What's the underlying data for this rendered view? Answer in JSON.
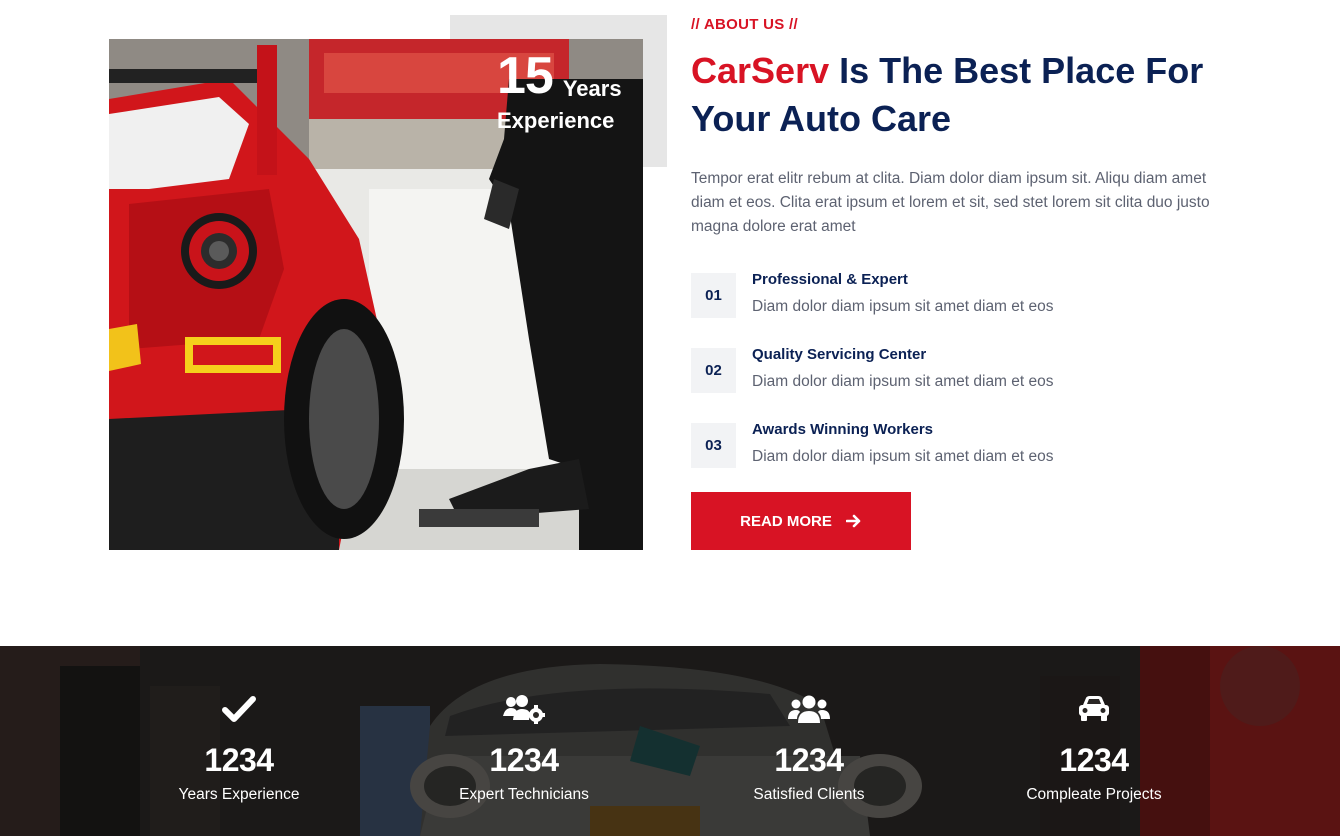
{
  "experience_badge": {
    "number": "15",
    "years": "Years",
    "label": "Experience"
  },
  "about": {
    "eyebrow": "// ABOUT US //",
    "headline_brand": "CarServ",
    "headline_rest": " Is The Best Place For Your Auto Care",
    "lead": "Tempor erat elitr rebum at clita. Diam dolor diam ipsum sit. Aliqu diam amet diam et eos. Clita erat ipsum et lorem et sit, sed stet lorem sit clita duo justo magna dolore erat amet",
    "features": [
      {
        "number": "01",
        "title": "Professional & Expert",
        "desc": "Diam dolor diam ipsum sit amet diam et eos"
      },
      {
        "number": "02",
        "title": "Quality Servicing Center",
        "desc": "Diam dolor diam ipsum sit amet diam et eos"
      },
      {
        "number": "03",
        "title": "Awards Winning Workers",
        "desc": "Diam dolor diam ipsum sit amet diam et eos"
      }
    ],
    "read_more_label": "READ MORE"
  },
  "facts": [
    {
      "icon": "check-icon",
      "number": "1234",
      "label": "Years Experience"
    },
    {
      "icon": "users-gear-icon",
      "number": "1234",
      "label": "Expert Technicians"
    },
    {
      "icon": "users-icon",
      "number": "1234",
      "label": "Satisfied Clients"
    },
    {
      "icon": "car-icon",
      "number": "1234",
      "label": "Compleate Projects"
    }
  ],
  "colors": {
    "primary": "#d81324",
    "dark": "#0b2154",
    "muted": "#5d6271",
    "light": "#f2f3f5"
  }
}
